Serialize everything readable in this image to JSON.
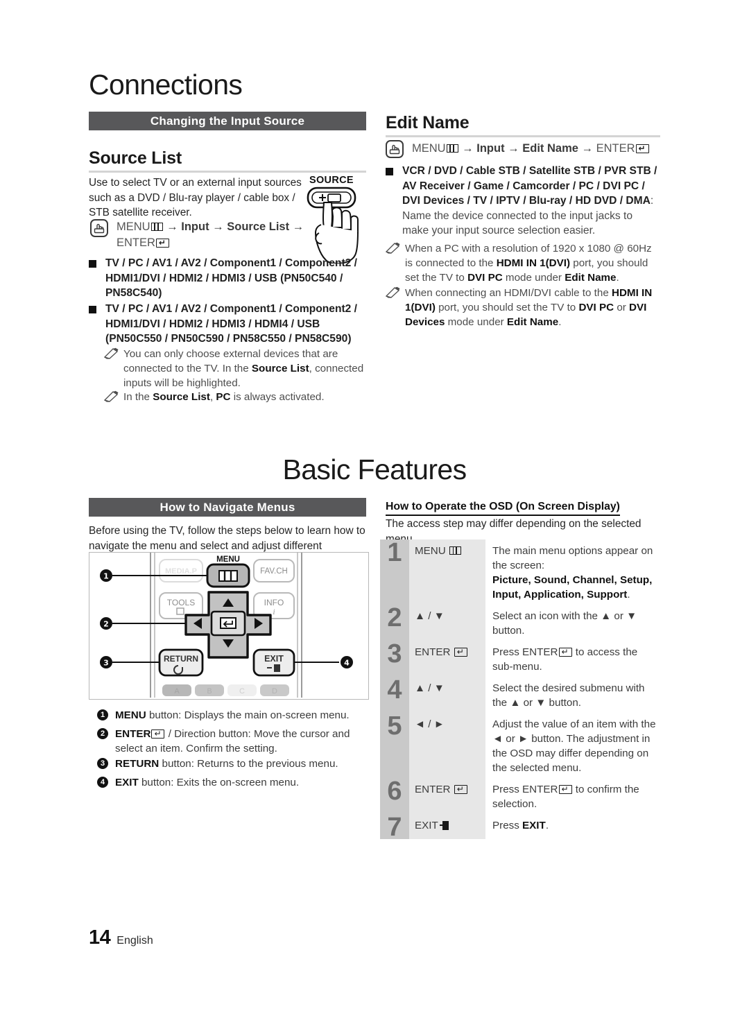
{
  "page": {
    "number": "14",
    "language": "English"
  },
  "chapters": {
    "connections": "Connections",
    "basic_features": "Basic Features"
  },
  "bands": {
    "changing_input_source": "Changing the Input Source",
    "how_to_navigate_menus": "How to Navigate Menus"
  },
  "source_list": {
    "heading": "Source List",
    "intro": "Use to select TV or an external input sources such as a DVD / Blu-ray player / cable box / STB satellite receiver.",
    "menu_path_prefix": "MENU",
    "menu_path_middle": " → Input → Source List → ",
    "menu_path_enter": "ENTER",
    "source_button_label": "SOURCE",
    "bullets": [
      {
        "bold": "TV / PC / AV1 / AV2 / Component1 / Component2 / HDMI1/DVI / HDMI2 / HDMI3 / USB (PN50C540 / PN58C540)"
      },
      {
        "bold": "TV / PC / AV1 / AV2 / Component1 / Component2 / HDMI1/DVI / HDMI2 / HDMI3 / HDMI4 / USB (PN50C550 / PN50C590 / PN58C550 / PN58C590)"
      }
    ],
    "notes": [
      {
        "p1": "You can only choose external devices that are connected to the TV. In the ",
        "b1": "Source List",
        "p2": ", connected inputs will be highlighted."
      },
      {
        "p1": "In the ",
        "b1": "Source List",
        "p2": ", ",
        "b2": "PC",
        "p3": " is always activated."
      }
    ]
  },
  "edit_name": {
    "heading": "Edit Name",
    "menu_path_prefix": "MENU",
    "menu_path_middle": " → Input → Edit Name → ",
    "menu_path_enter": "ENTER",
    "bullet_bold": "VCR / DVD / Cable STB / Satellite STB / PVR STB / AV Receiver / Game / Camcorder / PC / DVI PC / DVI Devices / TV / IPTV / Blu-ray / HD DVD / DMA",
    "bullet_normal": ": Name the device connected to the input jacks to make your input source selection easier.",
    "notes": [
      {
        "p1": "When a PC with a resolution of 1920 x 1080 @ 60Hz is connected to the ",
        "b1": "HDMI IN 1(DVI)",
        "p2": " port, you should set the TV to ",
        "b2": "DVI PC",
        "p3": " mode under ",
        "b3": "Edit Name",
        "p4": "."
      },
      {
        "p1": "When connecting an HDMI/DVI cable to the ",
        "b1": "HDMI IN 1(DVI)",
        "p2": " port, you should set the TV to ",
        "b2": "DVI PC",
        "p3": " or ",
        "b3": "DVI Devices",
        "p4": " mode under ",
        "b4": "Edit Name",
        "p5": "."
      }
    ]
  },
  "navigate_menus": {
    "intro": "Before using the TV, follow the steps below to learn how to navigate the menu and select and adjust different functions.",
    "remote": {
      "labels": {
        "menu": "MENU",
        "media_p": "MEDIA.P",
        "fav_ch": "FAV.CH",
        "tools": "TOOLS",
        "info": "INFO",
        "return": "RETURN",
        "exit": "EXIT",
        "color_a": "A",
        "color_b": "B",
        "color_c": "C",
        "color_d": "D"
      },
      "callouts": [
        "1",
        "2",
        "3",
        "4"
      ]
    },
    "legend": [
      {
        "num": "❶",
        "bold": "MENU",
        "text": " button: Displays the main on-screen menu."
      },
      {
        "num": "❷",
        "bold": "ENTER",
        "text": " / Direction button: Move the cursor and select an item. Confirm the setting."
      },
      {
        "num": "❸",
        "bold": "RETURN",
        "text": " button: Returns to the previous menu."
      },
      {
        "num": "❹",
        "bold": "EXIT",
        "text": " button: Exits the on-screen menu."
      }
    ]
  },
  "osd": {
    "heading": "How to Operate the OSD (On Screen Display)",
    "subtitle": "The access step may differ depending on the selected menu.",
    "steps": [
      {
        "num": "1",
        "button": "MENU",
        "button_glyph": "menu-glyph",
        "desc_plain": "The main menu options appear on the screen:",
        "desc_bold": "Picture, Sound, Channel, Setup, Input, Application, Support",
        "desc_tail": "."
      },
      {
        "num": "2",
        "button": "▲ / ▼",
        "button_glyph": "none",
        "desc_plain": "Select an icon with the ▲ or ▼ button.",
        "desc_bold": "",
        "desc_tail": ""
      },
      {
        "num": "3",
        "button": "ENTER",
        "button_glyph": "enter-glyph",
        "desc_plain": "Press ENTER",
        "desc_bold": "",
        "desc_tail": " to access the sub-menu."
      },
      {
        "num": "4",
        "button": "▲ / ▼",
        "button_glyph": "none",
        "desc_plain": "Select the desired submenu with the ▲ or ▼ button.",
        "desc_bold": "",
        "desc_tail": ""
      },
      {
        "num": "5",
        "button": "◄ / ►",
        "button_glyph": "none",
        "desc_plain": "Adjust the value of an item with the ◄ or ► button. The adjustment in the OSD may differ depending on the selected menu.",
        "desc_bold": "",
        "desc_tail": ""
      },
      {
        "num": "6",
        "button": "ENTER",
        "button_glyph": "enter-glyph",
        "desc_plain": "Press ENTER",
        "desc_bold": "",
        "desc_tail": " to confirm the selection."
      },
      {
        "num": "7",
        "button": "EXIT",
        "button_glyph": "exit-glyph",
        "desc_plain": "Press ",
        "desc_bold": "EXIT",
        "desc_tail": "."
      }
    ]
  },
  "colors": {
    "band_bg": "#58585a",
    "rule": "#d4d4d4",
    "osd_num_bg": "#c9c9c9",
    "osd_btn_bg": "#e7e7e7",
    "text": "#1a1a1a"
  }
}
